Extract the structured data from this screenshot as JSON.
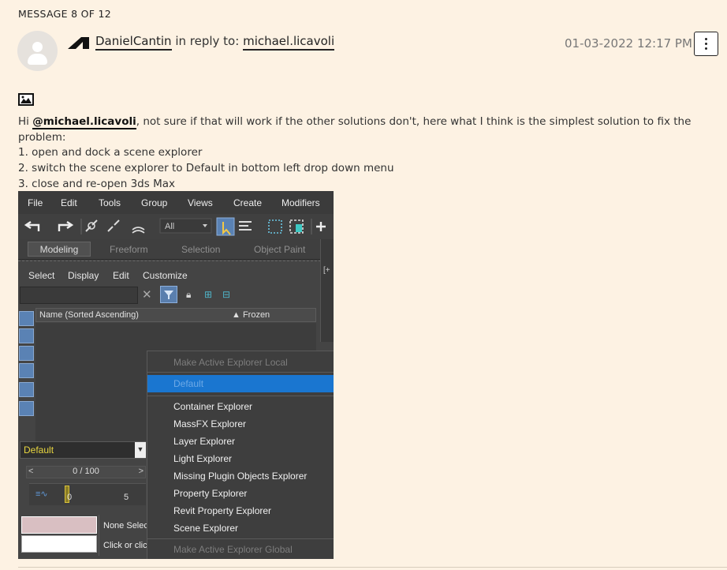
{
  "header": {
    "message_counter": "MESSAGE 8 OF 12",
    "author": "DanielCantin",
    "reply_prefix": "in reply to:",
    "reply_to": "michael.licavoli",
    "timestamp": "01-03-2022 12:17 PM"
  },
  "post": {
    "greeting": "Hi",
    "mention": "@michael.licavoli",
    "body_rest": ", not sure if that will work if the other solutions don't, here what I think is the simplest solution to fix the problem:",
    "steps": [
      "1. open and dock a scene explorer",
      "2. switch the scene explorer to Default in bottom left drop down menu",
      "3. close and re-open 3ds Max"
    ]
  },
  "screenshot": {
    "menubar": [
      "File",
      "Edit",
      "Tools",
      "Group",
      "Views",
      "Create",
      "Modifiers"
    ],
    "toolbar_dropdown": "All",
    "ribbon_tabs": [
      "Modeling",
      "Freeform",
      "Selection",
      "Object Paint"
    ],
    "explorer_menu": [
      "Select",
      "Display",
      "Edit",
      "Customize"
    ],
    "column_name": "Name (Sorted Ascending)",
    "column_frozen": "▲ Frozen",
    "explorer_dropdown": "Default",
    "time_slider": "0 / 100",
    "frame_labels": [
      "0",
      "5"
    ],
    "status_lines": [
      "None Selec",
      "Click or clic"
    ],
    "viewport_label": "[+"
  },
  "context_menu": {
    "top_item": "Make Active Explorer Local",
    "highlighted": "Default",
    "items": [
      "Container Explorer",
      "MassFX Explorer",
      "Layer Explorer",
      "Light Explorer",
      "Missing Plugin Objects Explorer",
      "Property Explorer",
      "Revit Property Explorer",
      "Scene Explorer"
    ],
    "bottom_item": "Make Active Explorer Global"
  },
  "icons": {
    "brand": "autodesk-logo-icon",
    "menu": "more-options-icon",
    "image": "image-icon"
  },
  "colors": {
    "page_bg": "#fdf2e3",
    "highlight": "#1a76d0",
    "max_ui": "#444444"
  }
}
